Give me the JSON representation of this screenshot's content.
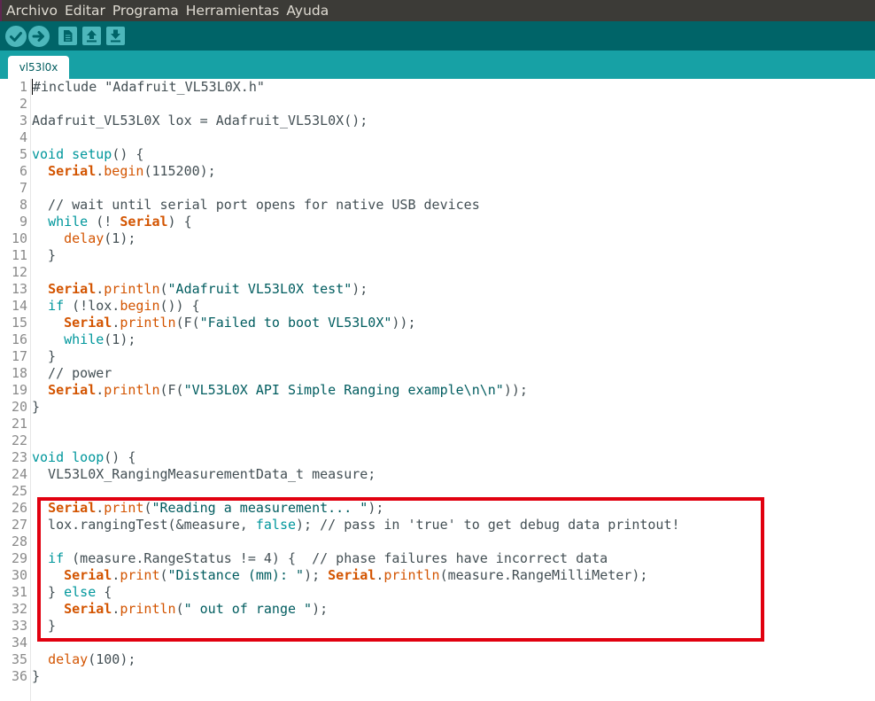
{
  "menu": [
    "Archivo",
    "Editar",
    "Programa",
    "Herramientas",
    "Ayuda"
  ],
  "toolbar": {
    "buttons": [
      {
        "name": "verify",
        "icon": "check-icon",
        "glyph": "✓"
      },
      {
        "name": "upload",
        "icon": "arrow-right-icon",
        "glyph": "➜"
      },
      {
        "name": "new",
        "icon": "new-file-icon",
        "glyph": "▤"
      },
      {
        "name": "open",
        "icon": "open-arrow-up-icon",
        "glyph": "⬆"
      },
      {
        "name": "save",
        "icon": "save-arrow-down-icon",
        "glyph": "⬇"
      }
    ]
  },
  "tab": {
    "label": "vl53l0x"
  },
  "editor": {
    "highlight": {
      "from_line": 26,
      "to_line": 33,
      "color": "#e1000f"
    },
    "lines": [
      {
        "n": "1",
        "segs": [
          [
            "caret",
            "#"
          ],
          [
            "cm",
            "include \"Adafruit_VL53L0X.h\""
          ]
        ]
      },
      {
        "n": "2",
        "segs": []
      },
      {
        "n": "3",
        "segs": [
          [
            "cm",
            "Adafruit_VL53L0X lox = Adafruit_VL53L0X();"
          ]
        ]
      },
      {
        "n": "4",
        "segs": []
      },
      {
        "n": "5",
        "segs": [
          [
            "kw",
            "void"
          ],
          [
            "cm",
            " "
          ],
          [
            "kw",
            "setup"
          ],
          [
            "cm",
            "() {"
          ]
        ]
      },
      {
        "n": "6",
        "segs": [
          [
            "cm",
            "  "
          ],
          [
            "obj",
            "Serial"
          ],
          [
            "cm",
            "."
          ],
          [
            "fn",
            "begin"
          ],
          [
            "cm",
            "(115200);"
          ]
        ]
      },
      {
        "n": "7",
        "segs": []
      },
      {
        "n": "8",
        "segs": [
          [
            "cm",
            "  // wait until serial port opens for native USB devices"
          ]
        ]
      },
      {
        "n": "9",
        "segs": [
          [
            "cm",
            "  "
          ],
          [
            "kw",
            "while"
          ],
          [
            "cm",
            " (! "
          ],
          [
            "obj",
            "Serial"
          ],
          [
            "cm",
            ") {"
          ]
        ]
      },
      {
        "n": "10",
        "segs": [
          [
            "cm",
            "    "
          ],
          [
            "fn",
            "delay"
          ],
          [
            "cm",
            "(1);"
          ]
        ]
      },
      {
        "n": "11",
        "segs": [
          [
            "cm",
            "  }"
          ]
        ]
      },
      {
        "n": "12",
        "segs": []
      },
      {
        "n": "13",
        "segs": [
          [
            "cm",
            "  "
          ],
          [
            "obj",
            "Serial"
          ],
          [
            "cm",
            "."
          ],
          [
            "fn",
            "println"
          ],
          [
            "cm",
            "("
          ],
          [
            "str",
            "\"Adafruit VL53L0X test\""
          ],
          [
            "cm",
            ");"
          ]
        ]
      },
      {
        "n": "14",
        "segs": [
          [
            "cm",
            "  "
          ],
          [
            "kw",
            "if"
          ],
          [
            "cm",
            " (!lox."
          ],
          [
            "fn",
            "begin"
          ],
          [
            "cm",
            "()) {"
          ]
        ]
      },
      {
        "n": "15",
        "segs": [
          [
            "cm",
            "    "
          ],
          [
            "obj",
            "Serial"
          ],
          [
            "cm",
            "."
          ],
          [
            "fn",
            "println"
          ],
          [
            "cm",
            "(F("
          ],
          [
            "str",
            "\"Failed to boot VL53L0X\""
          ],
          [
            "cm",
            "));"
          ]
        ]
      },
      {
        "n": "16",
        "segs": [
          [
            "cm",
            "    "
          ],
          [
            "kw",
            "while"
          ],
          [
            "cm",
            "(1);"
          ]
        ]
      },
      {
        "n": "17",
        "segs": [
          [
            "cm",
            "  }"
          ]
        ]
      },
      {
        "n": "18",
        "segs": [
          [
            "cm",
            "  // power"
          ]
        ]
      },
      {
        "n": "19",
        "segs": [
          [
            "cm",
            "  "
          ],
          [
            "obj",
            "Serial"
          ],
          [
            "cm",
            "."
          ],
          [
            "fn",
            "println"
          ],
          [
            "cm",
            "(F("
          ],
          [
            "str",
            "\"VL53L0X API Simple Ranging example\\n\\n\""
          ],
          [
            "cm",
            "));"
          ]
        ]
      },
      {
        "n": "20",
        "segs": [
          [
            "cm",
            "}"
          ]
        ]
      },
      {
        "n": "21",
        "segs": []
      },
      {
        "n": "22",
        "segs": []
      },
      {
        "n": "23",
        "segs": [
          [
            "kw",
            "void"
          ],
          [
            "cm",
            " "
          ],
          [
            "kw",
            "loop"
          ],
          [
            "cm",
            "() {"
          ]
        ]
      },
      {
        "n": "24",
        "segs": [
          [
            "cm",
            "  VL53L0X_RangingMeasurementData_t measure;"
          ]
        ]
      },
      {
        "n": "25",
        "segs": []
      },
      {
        "n": "26",
        "segs": [
          [
            "cm",
            "  "
          ],
          [
            "obj",
            "Serial"
          ],
          [
            "cm",
            "."
          ],
          [
            "fn",
            "print"
          ],
          [
            "cm",
            "("
          ],
          [
            "str",
            "\"Reading a measurement... \""
          ],
          [
            "cm",
            ");"
          ]
        ]
      },
      {
        "n": "27",
        "segs": [
          [
            "cm",
            "  lox.rangingTest(&measure, "
          ],
          [
            "lit",
            "false"
          ],
          [
            "cm",
            "); // pass in 'true' to get debug data printout!"
          ]
        ]
      },
      {
        "n": "28",
        "segs": []
      },
      {
        "n": "29",
        "segs": [
          [
            "cm",
            "  "
          ],
          [
            "kw",
            "if"
          ],
          [
            "cm",
            " (measure.RangeStatus != 4) {  // phase failures have incorrect data"
          ]
        ]
      },
      {
        "n": "30",
        "segs": [
          [
            "cm",
            "    "
          ],
          [
            "obj",
            "Serial"
          ],
          [
            "cm",
            "."
          ],
          [
            "fn",
            "print"
          ],
          [
            "cm",
            "("
          ],
          [
            "str",
            "\"Distance (mm): \""
          ],
          [
            "cm",
            "); "
          ],
          [
            "obj",
            "Serial"
          ],
          [
            "cm",
            "."
          ],
          [
            "fn",
            "println"
          ],
          [
            "cm",
            "(measure.RangeMilliMeter);"
          ]
        ]
      },
      {
        "n": "31",
        "segs": [
          [
            "cm",
            "  } "
          ],
          [
            "kw",
            "else"
          ],
          [
            "cm",
            " {"
          ]
        ]
      },
      {
        "n": "32",
        "segs": [
          [
            "cm",
            "    "
          ],
          [
            "obj",
            "Serial"
          ],
          [
            "cm",
            "."
          ],
          [
            "fn",
            "println"
          ],
          [
            "cm",
            "("
          ],
          [
            "str",
            "\" out of range \""
          ],
          [
            "cm",
            ");"
          ]
        ]
      },
      {
        "n": "33",
        "segs": [
          [
            "cm",
            "  }"
          ]
        ]
      },
      {
        "n": "34",
        "segs": []
      },
      {
        "n": "35",
        "segs": [
          [
            "cm",
            "  "
          ],
          [
            "fn",
            "delay"
          ],
          [
            "cm",
            "(100);"
          ]
        ]
      },
      {
        "n": "36",
        "segs": [
          [
            "cm",
            "}"
          ]
        ]
      }
    ]
  }
}
